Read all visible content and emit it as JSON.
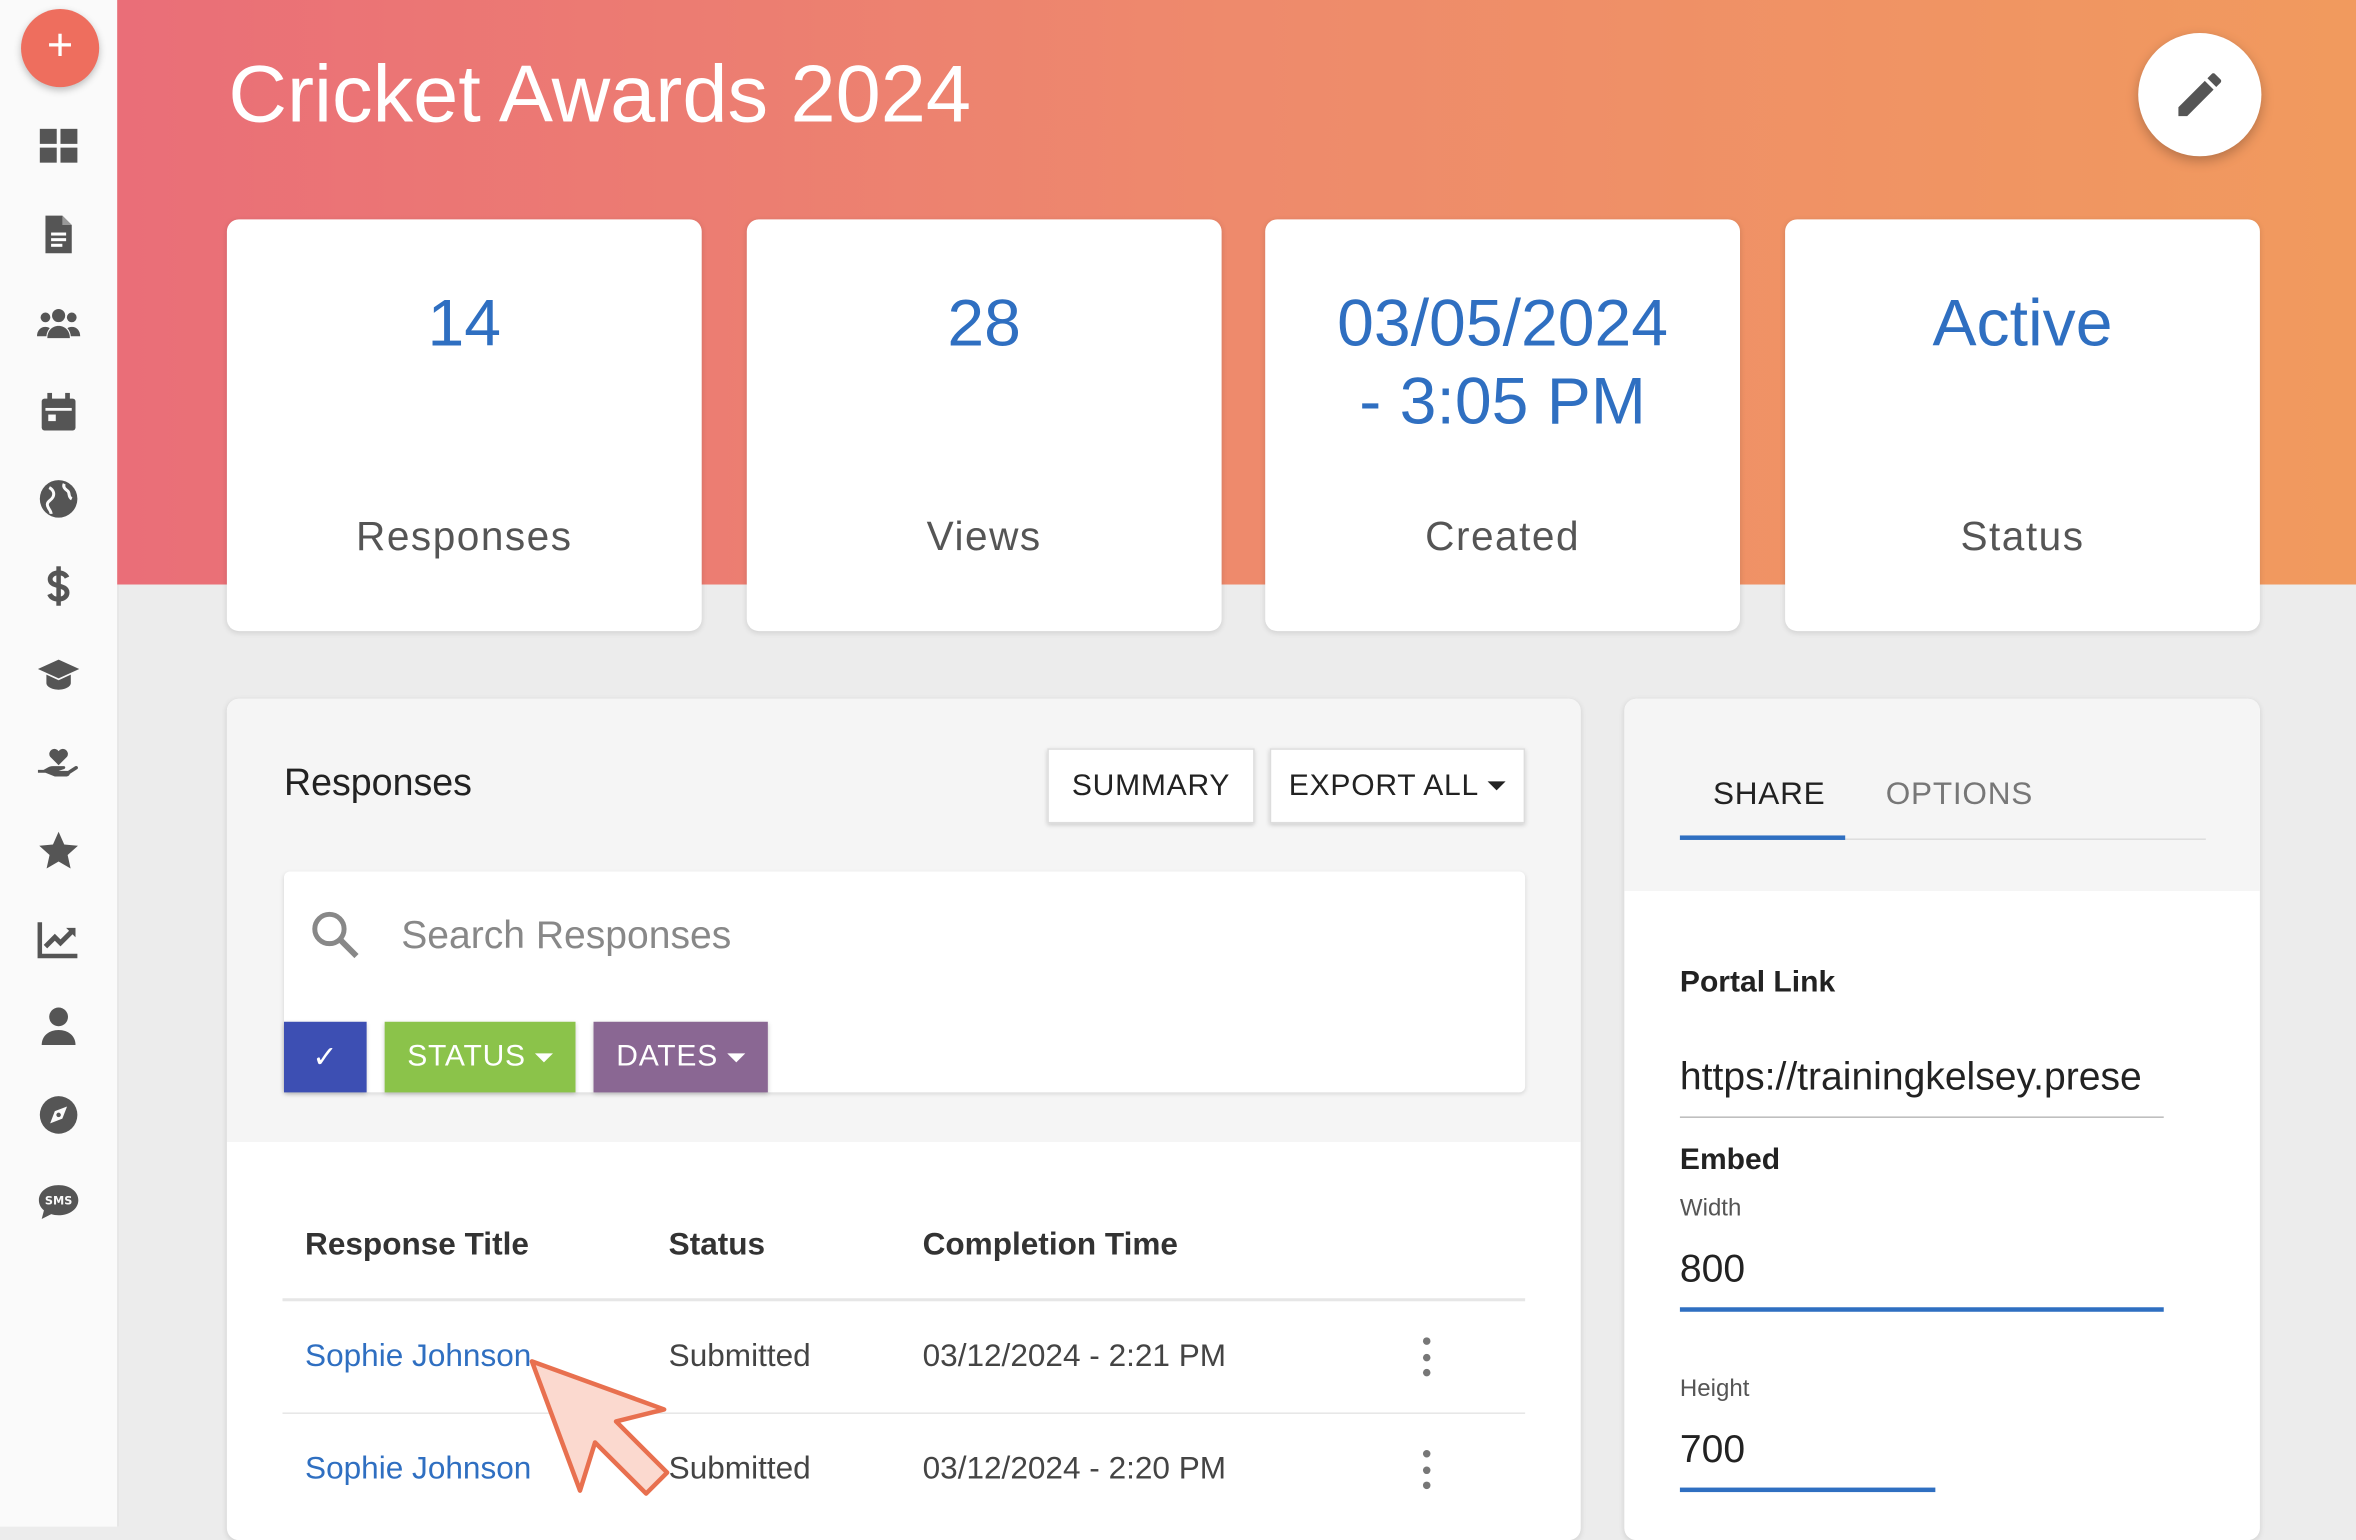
{
  "app": {
    "title": "Cricket Awards 2024",
    "add_label": "+"
  },
  "sidebar": {
    "items": [
      {
        "icon": "dashboard-icon"
      },
      {
        "icon": "document-icon"
      },
      {
        "icon": "users-icon"
      },
      {
        "icon": "calendar-icon"
      },
      {
        "icon": "globe-icon"
      },
      {
        "icon": "dollar-icon"
      },
      {
        "icon": "graduation-cap-icon"
      },
      {
        "icon": "hand-heart-icon"
      },
      {
        "icon": "star-icon"
      },
      {
        "icon": "chart-line-icon"
      },
      {
        "icon": "user-icon"
      },
      {
        "icon": "compass-icon"
      },
      {
        "icon": "sms-icon",
        "badge": "SMS"
      }
    ]
  },
  "stats": [
    {
      "value": "14",
      "label": "Responses"
    },
    {
      "value": "28",
      "label": "Views"
    },
    {
      "value": "03/05/2024 - 3:05 PM",
      "label": "Created"
    },
    {
      "value": "Active",
      "label": "Status"
    }
  ],
  "responses": {
    "title": "Responses",
    "summary_label": "SUMMARY",
    "export_label": "EXPORT ALL",
    "search_placeholder": "Search Responses",
    "filters": {
      "check": "✓",
      "status": "STATUS",
      "dates": "DATES"
    },
    "columns": [
      "Response Title",
      "Status",
      "Completion Time"
    ],
    "rows": [
      {
        "title": "Sophie Johnson",
        "status": "Submitted",
        "time": "03/12/2024 - 2:21 PM"
      },
      {
        "title": "Sophie Johnson",
        "status": "Submitted",
        "time": "03/12/2024 - 2:20 PM"
      }
    ]
  },
  "share": {
    "tabs": [
      "SHARE",
      "OPTIONS"
    ],
    "active_tab": "SHARE",
    "portal_label": "Portal Link",
    "portal_url": "https://trainingkelsey.prese",
    "embed_label": "Embed",
    "width_label": "Width",
    "width_value": "800",
    "height_label": "Height",
    "height_value": "700"
  },
  "colors": {
    "accent": "#2f6fc1",
    "header_start": "#ea6e78",
    "header_end": "#f19a5e",
    "filter_check": "#3d4fb3",
    "filter_status": "#8bc34a",
    "filter_dates": "#8a6793"
  }
}
